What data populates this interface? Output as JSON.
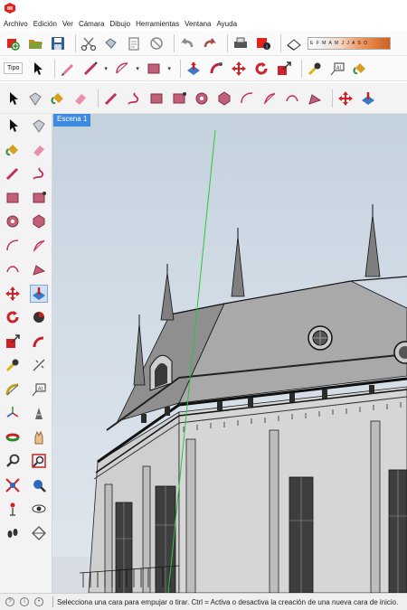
{
  "app": {
    "logo_icon": "sketchup-logo-icon",
    "accent": "#e3231a"
  },
  "menu": [
    "Archivo",
    "Edición",
    "Ver",
    "Cámara",
    "Dibujo",
    "Herramientas",
    "Ventana",
    "Ayuda"
  ],
  "toolbar_style_label": "Tipo",
  "shadow_months": "E F M A M J J A S O",
  "scene_tab": "Escena 1",
  "status_text": "Selecciona una cara para empujar o tirar. Ctrl = Activa o desactiva la creación de una nueva cara de inicio.",
  "colors": {
    "scene_tab": "#3c8be0",
    "axis_green": "#2ec43a",
    "sky": "#d3dde7"
  },
  "icons": {
    "toolbar1": [
      "new-model-icon",
      "open-icon",
      "save-icon",
      "cut-icon",
      "copy-icon",
      "paste-icon",
      "erase-icon",
      "undo-icon",
      "redo-icon",
      "print-icon",
      "model-info-icon",
      "shadows-icon"
    ],
    "toolbar2": [
      "select-icon",
      "line-icon",
      "arc-icon",
      "rectangle-icon",
      "push-pull-icon",
      "follow-me-icon",
      "move-icon",
      "rotate-icon",
      "scale-icon",
      "tape-measure-icon",
      "text-icon",
      "paint-bucket-icon"
    ],
    "toolbar3": [
      "select-icon",
      "component-icon",
      "paint-bucket-icon",
      "eraser-icon",
      "line-icon",
      "freehand-icon",
      "rectangle-icon",
      "rotated-rectangle-icon",
      "circle-icon",
      "polygon-icon",
      "arc-icon",
      "pie-icon",
      "two-point-arc-icon",
      "three-point-arc-icon",
      "move-icon",
      "push-pull-icon"
    ]
  }
}
